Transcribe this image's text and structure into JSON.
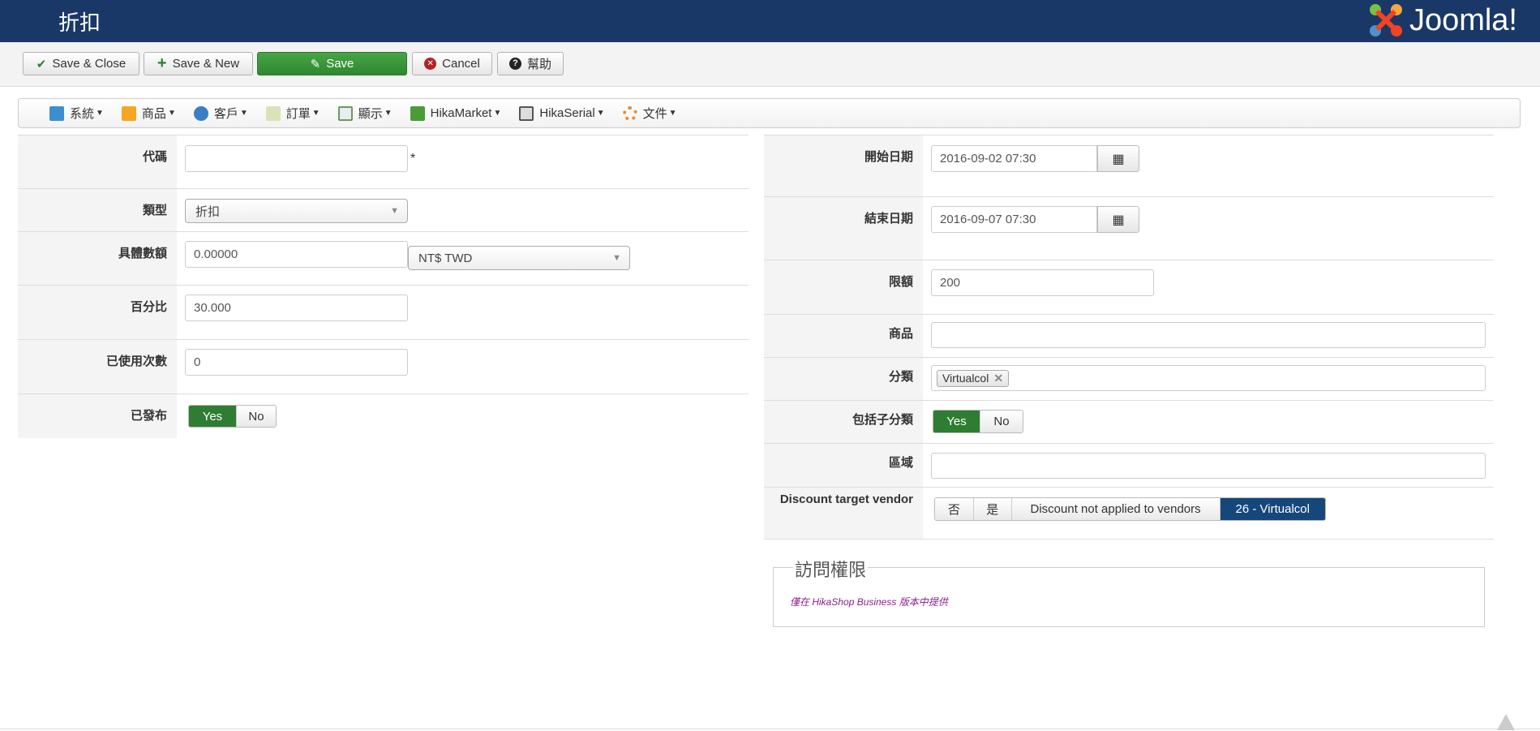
{
  "header": {
    "title": "折扣",
    "logo_text": "Joomla!"
  },
  "toolbar": {
    "save_close": "Save & Close",
    "save_new": "Save & New",
    "save": "Save",
    "cancel": "Cancel",
    "help": "幫助"
  },
  "menu": [
    {
      "label": "系統",
      "color": "#3b8fd0"
    },
    {
      "label": "商品",
      "color": "#f5a623"
    },
    {
      "label": "客戶",
      "color": "#3a7fc4"
    },
    {
      "label": "訂單",
      "color": "#9ab55a"
    },
    {
      "label": "顯示",
      "color": "#c94a3a"
    },
    {
      "label": "HikaMarket",
      "color": "#4b9b3a"
    },
    {
      "label": "HikaSerial",
      "color": "#555555"
    },
    {
      "label": "文件",
      "color": "#e88a2a"
    }
  ],
  "left": {
    "code": {
      "label": "代碼",
      "value": "",
      "required": "*"
    },
    "type": {
      "label": "類型",
      "value": "折扣"
    },
    "amount": {
      "label": "具體數額",
      "value": "0.00000",
      "currency": "NT$ TWD"
    },
    "percent": {
      "label": "百分比",
      "value": "30.000"
    },
    "used": {
      "label": "已使用次數",
      "value": "0"
    },
    "published": {
      "label": "已發布",
      "yes": "Yes",
      "no": "No",
      "selected": "Yes"
    }
  },
  "right": {
    "start": {
      "label": "開始日期",
      "value": "2016-09-02 07:30"
    },
    "end": {
      "label": "結束日期",
      "value": "2016-09-07 07:30"
    },
    "limit": {
      "label": "限額",
      "value": "200"
    },
    "product": {
      "label": "商品",
      "value": ""
    },
    "category": {
      "label": "分類",
      "tag": "Virtualcol"
    },
    "subcat": {
      "label": "包括子分類",
      "yes": "Yes",
      "no": "No",
      "selected": "Yes"
    },
    "zone": {
      "label": "區域",
      "value": ""
    },
    "vendor": {
      "label": "Discount target vendor",
      "options": [
        "否",
        "是",
        "Discount not applied to vendors",
        "26 - Virtualcol"
      ],
      "selected": "26 - Virtualcol"
    }
  },
  "access": {
    "legend": "訪問權限",
    "note": "僅在 HikaShop Business 版本中提供"
  }
}
